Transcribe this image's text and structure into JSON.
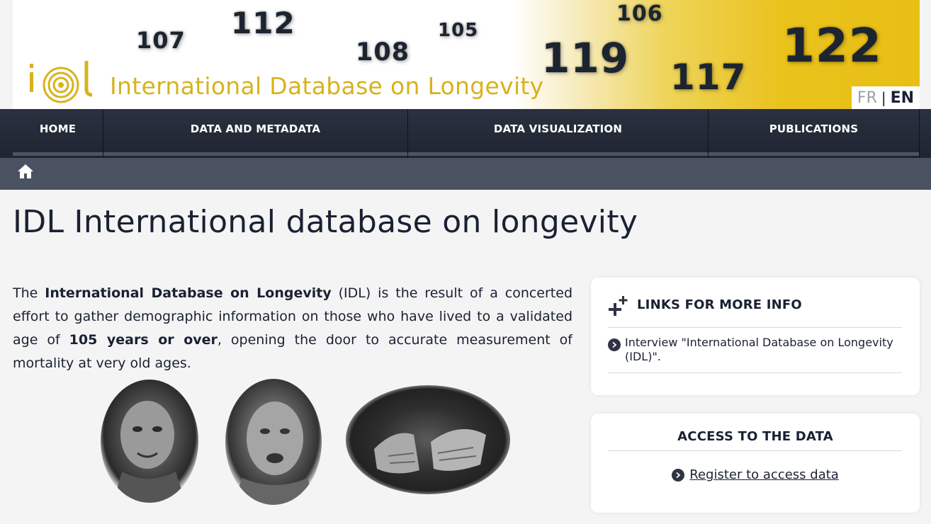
{
  "banner": {
    "numbers": [
      "107",
      "112",
      "108",
      "105",
      "119",
      "106",
      "117",
      "122"
    ],
    "title": "International Database on Longevity",
    "logo_text": "idl"
  },
  "lang": {
    "fr": "FR",
    "en": "EN"
  },
  "nav": {
    "items": [
      {
        "label": "HOME"
      },
      {
        "label": "DATA AND METADATA"
      },
      {
        "label": "DATA VISUALIZATION"
      },
      {
        "label": "PUBLICATIONS"
      }
    ]
  },
  "page": {
    "title": "IDL International database on longevity"
  },
  "intro": {
    "p1": "The ",
    "b1": "International Database on Longevity",
    "p2": " (IDL) is the result of a concerted effort to gather demographic information on those who have lived to a validated age of ",
    "b2": "105 years or over",
    "p3": ", opening the door to accurate measurement of mortality at very old ages."
  },
  "links_card": {
    "title": "LINKS FOR MORE INFO",
    "items": [
      {
        "label": "Interview \"International Database on Longevity (IDL)\"."
      }
    ]
  },
  "access_card": {
    "title": "ACCESS TO THE DATA",
    "link": "Register to access data"
  },
  "colors": {
    "nav_bg": "#232a36",
    "breadcrumb_bg": "#4a5262",
    "brand_yellow": "#d8b21c",
    "page_bg": "#f4f4f4"
  }
}
